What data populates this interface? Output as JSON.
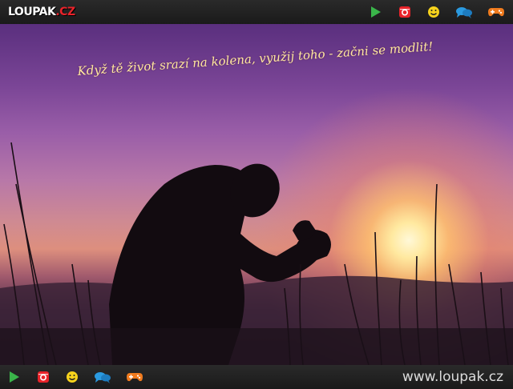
{
  "header": {
    "logo_text": "LOUPAK",
    "logo_tld": ".CZ",
    "icons": [
      "play-icon",
      "instagram-icon",
      "smiley-icon",
      "chat-icon",
      "gamepad-icon"
    ]
  },
  "content": {
    "quote": "Když tě život srazí na kolena, využij toho - začni se modlit!"
  },
  "footer": {
    "icons": [
      "play-icon",
      "instagram-icon",
      "smiley-icon",
      "chat-icon",
      "gamepad-icon"
    ],
    "site_url": "www.loupak.cz"
  },
  "colors": {
    "play": "#3ab54a",
    "instagram": "#e8232a",
    "smiley": "#f6d21c",
    "chat": "#2b9ae0",
    "gamepad": "#f07b1e",
    "quote_text": "#ffe9a0"
  }
}
